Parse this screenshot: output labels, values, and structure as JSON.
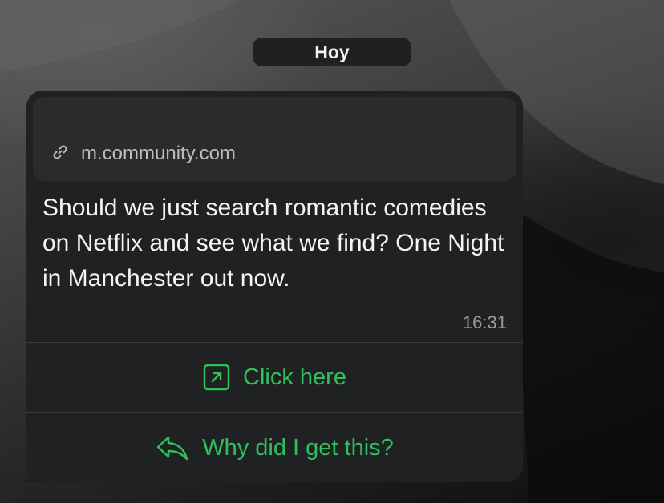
{
  "date_separator": "Hoy",
  "message": {
    "link_preview": {
      "icon": "link-icon",
      "domain": "m.community.com"
    },
    "text": "Should we just search romantic comedies on Netflix and see what we find? One Night in Manchester out now.",
    "time": "16:31"
  },
  "actions": [
    {
      "label": "Click here",
      "icon": "external-link-icon"
    },
    {
      "label": "Why did I get this?",
      "icon": "reply-icon"
    }
  ],
  "colors": {
    "bubble": "#202122",
    "link_preview_bg": "#2a2b2c",
    "action_green": "#2fbf5e",
    "text": "#f4f4f4",
    "muted": "#9a9a9a"
  }
}
